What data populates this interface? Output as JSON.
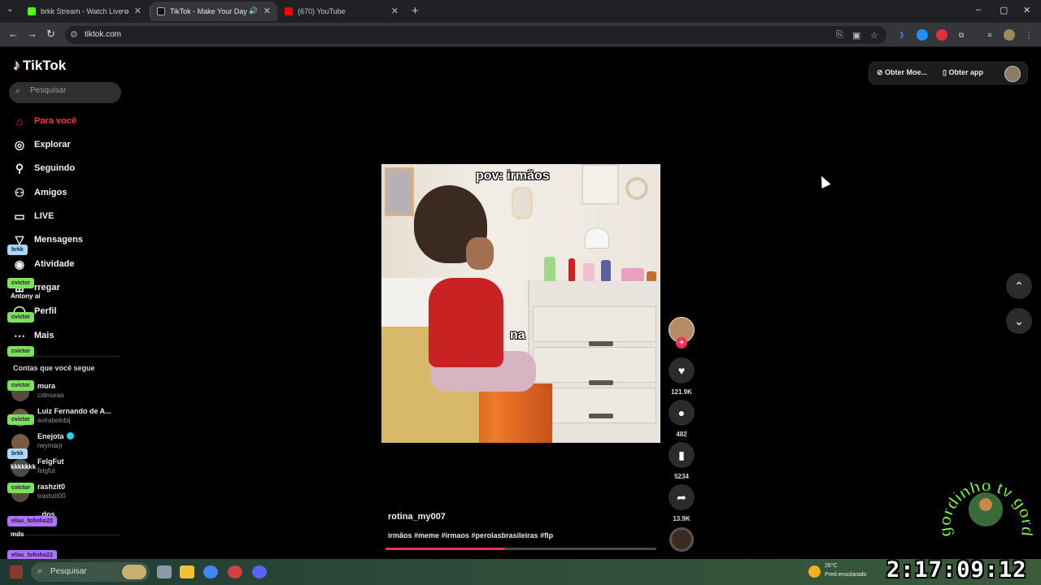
{
  "browser": {
    "tabs": [
      {
        "title": "brkk Stream - Watch Live o",
        "active": false,
        "color": "#53fc18"
      },
      {
        "title": "TikTok - Make Your Day",
        "active": true,
        "color": "#ffffff"
      },
      {
        "title": "(670) YouTube",
        "active": false,
        "color": "#ff0000"
      }
    ],
    "url": "tiktok.com"
  },
  "tiktok": {
    "logo": "TikTok",
    "search_placeholder": "Pesquisar",
    "nav": [
      {
        "label": "Para você",
        "icon": "home-icon",
        "active": true
      },
      {
        "label": "Explorar",
        "icon": "compass-icon",
        "active": false
      },
      {
        "label": "Seguindo",
        "icon": "user-follow-icon",
        "active": false
      },
      {
        "label": "Amigos",
        "icon": "friends-icon",
        "active": false
      },
      {
        "label": "LIVE",
        "icon": "live-icon",
        "active": false
      },
      {
        "label": "Mensagens",
        "icon": "messages-icon",
        "active": false
      },
      {
        "label": "Atividade",
        "icon": "activity-icon",
        "active": false
      },
      {
        "label": "rregar",
        "icon": "upload-icon",
        "active": false
      },
      {
        "label": "Perfil",
        "icon": "profile-icon",
        "active": false
      },
      {
        "label": "Mais",
        "icon": "more-icon",
        "active": false
      }
    ],
    "following_header": "Contas que você segue",
    "following": [
      {
        "name": "mura",
        "handle": "cxlmuraa",
        "verified": false
      },
      {
        "name": "Luiz Fernando de A...",
        "handle": "avirabelobij",
        "verified": false
      },
      {
        "name": "Enejota",
        "handle": "neymarjr",
        "verified": true
      },
      {
        "name": "FelgFut",
        "handle": "felgfut",
        "verified": false
      },
      {
        "name": "rashzit0",
        "handle": "trashzit00",
        "verified": false
      }
    ],
    "see_more": "...dos",
    "top_buttons": {
      "coins": "Obter Moe...",
      "app": "Obter app"
    },
    "video": {
      "caption_top": "pov: irmãos",
      "caption_mid": "na",
      "username": "rotina_my007",
      "description": "irmãos #meme #irmaos #perolasbrasileiras #flp",
      "progress": 0.44
    },
    "actions": {
      "likes": "121.9K",
      "comments": "482",
      "saves": "5234",
      "shares": "13.9K"
    }
  },
  "stream_chat": [
    {
      "tag": "brkk",
      "color": "#a8d8ff",
      "message": ""
    },
    {
      "tag": "cvictor",
      "color": "#7be05a",
      "message": "Antony aí"
    },
    {
      "tag": "cvictor",
      "color": "#7be05a",
      "message": ""
    },
    {
      "tag": "cvictor",
      "color": "#7be05a",
      "message": ""
    },
    {
      "tag": "cvictor",
      "color": "#7be05a",
      "message": ""
    },
    {
      "tag": "cvictor",
      "color": "#7be05a",
      "message": ""
    },
    {
      "tag": "brkk",
      "color": "#a8d8ff",
      "message": "kkkkkkk"
    },
    {
      "tag": "cvictor",
      "color": "#7be05a",
      "message": ""
    },
    {
      "tag": "elias_fofinho22",
      "color": "#b070ff",
      "message": "mds"
    },
    {
      "tag": "elias_fofinho22",
      "color": "#b070ff",
      "message": ""
    }
  ],
  "taskbar": {
    "search_label": "Pesquisar",
    "weather_temp": "26°C",
    "weather_desc": "Pred ensolarado"
  },
  "overlay": {
    "clock": "2:17:09:12",
    "watermark": "gordinho tv gordinho tv"
  }
}
